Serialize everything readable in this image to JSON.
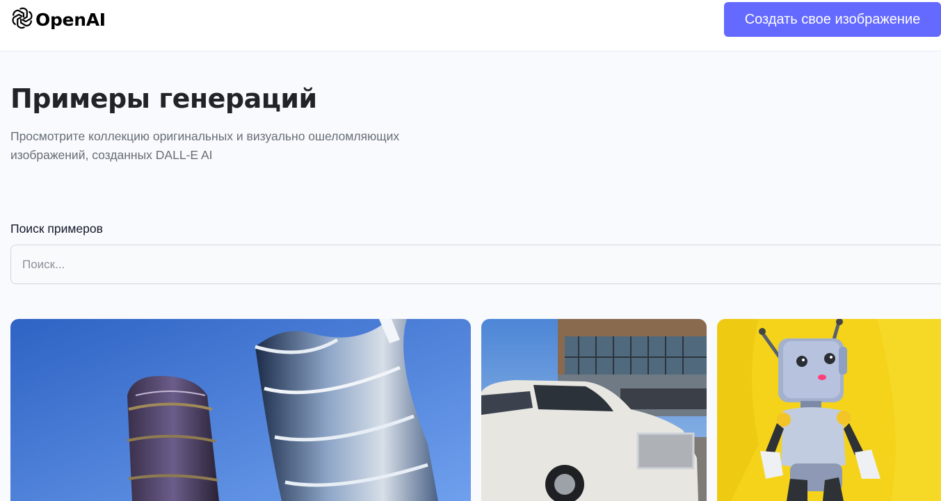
{
  "header": {
    "logo_text": "OpenAI",
    "create_button_label": "Создать свое изображение",
    "accent_color": "#6469ff"
  },
  "hero": {
    "title": "Примеры генераций",
    "subtitle": "Просмотрите коллекцию оригинальных и визуально ошеломляющих изображений, созданных DALL-E AI"
  },
  "search": {
    "label": "Поиск примеров",
    "value": "",
    "placeholder": "Поиск..."
  },
  "gallery": {
    "items": [
      {
        "image": "moscow-city-towers"
      },
      {
        "image": "white-suv-parking"
      },
      {
        "image": "toy-robot-yellow-wall"
      }
    ]
  }
}
